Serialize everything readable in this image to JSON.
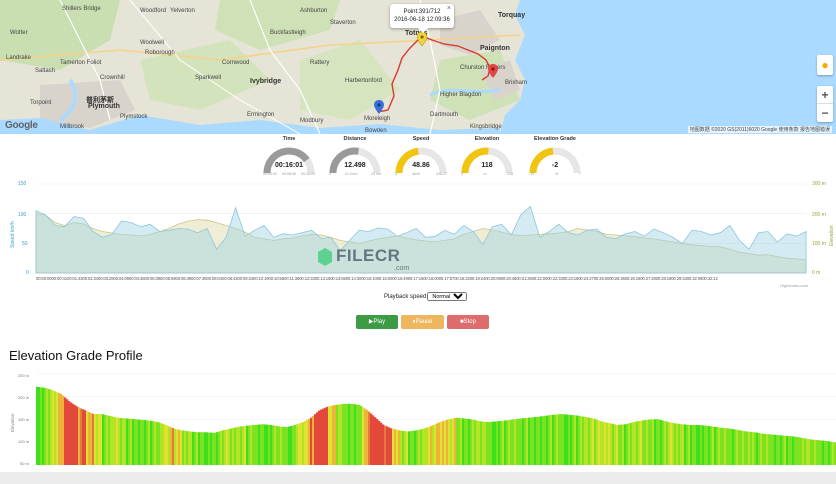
{
  "map": {
    "popup": {
      "point": "Point:391/712",
      "time": "2016-06-18 12:09:36",
      "close": "×"
    },
    "google_logo": "Google",
    "attribution": "地图数据 ©2020 GS(2011)6020 Google   使用条款   报告地图错误",
    "zoom_in": "+",
    "zoom_out": "−",
    "labels": [
      {
        "t": "Shillers Bridge"
      },
      {
        "t": "Woodford"
      },
      {
        "t": "Woolwell"
      },
      {
        "t": "Roborough"
      },
      {
        "t": "Tamerton Foliot"
      },
      {
        "t": "Crownhill"
      },
      {
        "t": "Landrake"
      },
      {
        "t": "Saltash"
      },
      {
        "t": "Torpoint"
      },
      {
        "t": "Plymouth"
      },
      {
        "t": "普利茅斯"
      },
      {
        "t": "Plymstock"
      },
      {
        "t": "Yelverton"
      },
      {
        "t": "Sparkwell"
      },
      {
        "t": "Cornwood"
      },
      {
        "t": "Ivybridge"
      },
      {
        "t": "Ermington"
      },
      {
        "t": "Modbury"
      },
      {
        "t": "Harbertonford"
      },
      {
        "t": "Totnes"
      },
      {
        "t": "Kingsbridge"
      },
      {
        "t": "Paignton"
      },
      {
        "t": "Torquay"
      },
      {
        "t": "Brixham"
      },
      {
        "t": "Moreleigh"
      },
      {
        "t": "Bowden"
      },
      {
        "t": "Millbrook"
      },
      {
        "t": "Dartmouth"
      },
      {
        "t": "Churston Ferrers"
      },
      {
        "t": "Staverton"
      },
      {
        "t": "Ashburton"
      },
      {
        "t": "Buckfastleigh"
      },
      {
        "t": "Rattery"
      },
      {
        "t": "Wotter"
      },
      {
        "t": "Higher Blagdon"
      }
    ]
  },
  "gauges": [
    {
      "label": "Time",
      "value": "00:16:01",
      "scale": [
        "00:00:00",
        "00:08:00",
        "00:16:00"
      ],
      "fill": 0.8,
      "color": "#9a9a9a"
    },
    {
      "label": "Distance",
      "value": "12.498",
      "scale": [
        "0",
        "11.5 km",
        "23 km"
      ],
      "fill": 0.55,
      "color": "#9a9a9a"
    },
    {
      "label": "Speed",
      "value": "48.86",
      "scale": [
        "0",
        "km/h",
        "106.27"
      ],
      "fill": 0.46,
      "color": "#f1c40f"
    },
    {
      "label": "Elevation",
      "value": "118",
      "scale": [
        "0",
        "m",
        "228"
      ],
      "fill": 0.52,
      "color": "#f1c40f"
    },
    {
      "label": "Elevation Grade",
      "value": "-2",
      "scale": [
        "-10",
        "%",
        "7"
      ],
      "fill": 0.47,
      "color": "#f1c40f"
    }
  ],
  "chart": {
    "y_left_label": "Speed km/h",
    "y_right_label": "Elevation",
    "y_left_ticks": [
      "150",
      "100",
      "50",
      "0"
    ],
    "y_right_ticks": [
      "300 m",
      "200 m",
      "100 m",
      "0 m"
    ],
    "x_ticks": "00:00:0000:00:4100:01:4300:02:3400:03:2900:04:0900:04:4800:05:3900:05:5900:06:3900:07:3600:08:0400:08:4300:09:3400:10:1900:10:5500:11:3600:12:3300:13:1500:13:5500:14:3000:15:1000:16:0000:16:4900:17:1600:18:0000:17:5700:18:3200:19:2400:20:0800:20:4800:21:3500:22:0000:22:3300:23:1600:24:2700:25:0000:25:3600:26:1800:27:2800:28:1900:29:3300:32:0900:32:12",
    "credit": "Highcharts.com"
  },
  "chart_data": {
    "type": "area",
    "series": [
      {
        "name": "Speed km/h",
        "values": [
          105,
          98,
          80,
          78,
          95,
          92,
          70,
          60,
          65,
          88,
          85,
          78,
          82,
          70,
          72,
          75,
          74,
          68,
          75,
          40,
          60,
          110,
          62,
          72,
          80,
          60,
          66,
          64,
          68,
          72,
          58,
          60,
          38,
          55,
          72,
          70,
          76,
          74,
          62,
          68,
          75,
          60,
          62,
          72,
          65,
          80,
          70,
          48,
          78,
          82,
          64,
          98,
          112,
          60,
          70,
          82,
          68,
          64,
          72,
          74,
          60,
          58,
          66,
          70,
          62,
          74,
          68,
          60,
          50,
          72,
          70,
          64,
          68,
          80,
          55,
          40,
          68,
          70,
          52,
          66,
          62,
          70
        ]
      },
      {
        "name": "Elevation",
        "values": [
          200,
          195,
          170,
          160,
          170,
          165,
          150,
          140,
          135,
          130,
          128,
          125,
          130,
          140,
          150,
          165,
          175,
          180,
          178,
          170,
          160,
          150,
          138,
          120,
          115,
          110,
          115,
          118,
          125,
          130,
          128,
          120,
          110,
          105,
          100,
          108,
          115,
          120,
          125,
          118,
          112,
          108,
          105,
          110,
          115,
          130,
          140,
          150,
          145,
          138,
          130,
          125,
          128,
          130,
          132,
          135,
          140,
          150,
          145,
          140,
          130,
          128,
          125,
          122,
          118,
          115,
          110,
          105,
          100,
          95,
          92,
          90,
          88,
          80,
          70,
          65,
          60,
          62,
          55,
          50,
          48,
          45
        ]
      }
    ],
    "ylim_left": [
      0,
      150
    ],
    "ylim_right": [
      0,
      300
    ]
  },
  "controls": {
    "playback_label": "Playback speed",
    "speed_option": "Normal",
    "play": "▶Play",
    "pause": "⏸Pause",
    "stop": "■Stop"
  },
  "grade": {
    "title": "Elevation Grade Profile",
    "y_label": "Elevation",
    "y_ticks": [
      "250 m",
      "200 m",
      "150 m",
      "100 m",
      "50 m"
    ]
  },
  "grade_data": {
    "type": "area",
    "elevation": [
      215,
      212,
      205,
      195,
      175,
      160,
      150,
      140,
      140,
      135,
      130,
      128,
      126,
      124,
      122,
      118,
      110,
      100,
      95,
      92,
      90,
      90,
      88,
      95,
      100,
      105,
      108,
      110,
      112,
      110,
      106,
      104,
      110,
      118,
      130,
      150,
      160,
      165,
      168,
      168,
      165,
      150,
      130,
      110,
      100,
      95,
      92,
      95,
      100,
      108,
      118,
      125,
      130,
      128,
      125,
      120,
      118,
      120,
      122,
      125,
      128,
      130,
      132,
      135,
      138,
      140,
      138,
      136,
      132,
      128,
      120,
      115,
      110,
      112,
      118,
      122,
      125,
      126,
      120,
      115,
      112,
      110,
      110,
      108,
      105,
      102,
      100,
      96,
      92,
      90,
      86,
      84,
      82,
      80,
      78,
      74,
      70,
      68,
      66,
      62
    ],
    "colors": [
      "#3ee01e",
      "#7be320",
      "#b4e426",
      "#dfe230",
      "#ecb53a",
      "#e57b3a",
      "#e2493a"
    ]
  }
}
